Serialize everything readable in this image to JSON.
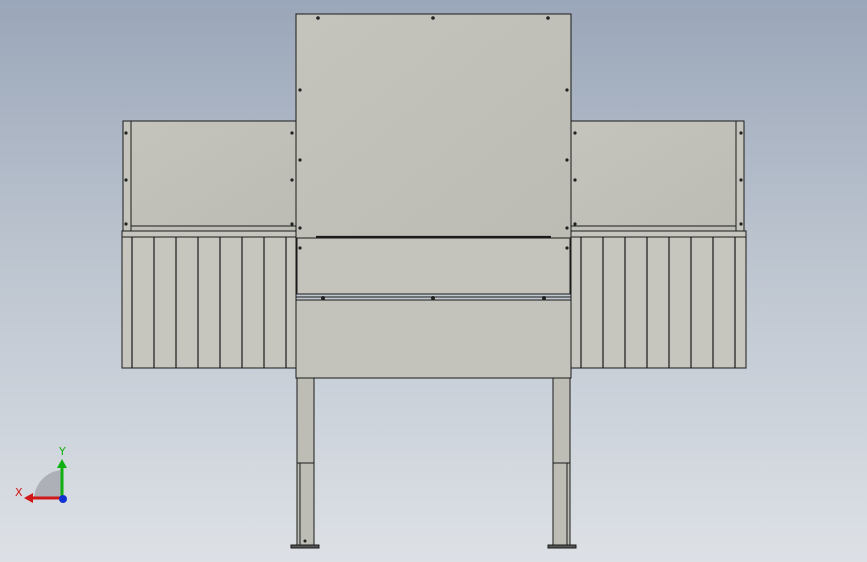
{
  "colors": {
    "panel_fill": "#c2c2ba",
    "panel_fill_light": "#c7c7bf",
    "outline": "#1a1a1a",
    "leg_fill": "#bdbdb5",
    "axis_x": "#d01818",
    "axis_y": "#10b010",
    "axis_z": "#1030d0"
  },
  "triad": {
    "x_label": "X",
    "y_label": "Y"
  }
}
